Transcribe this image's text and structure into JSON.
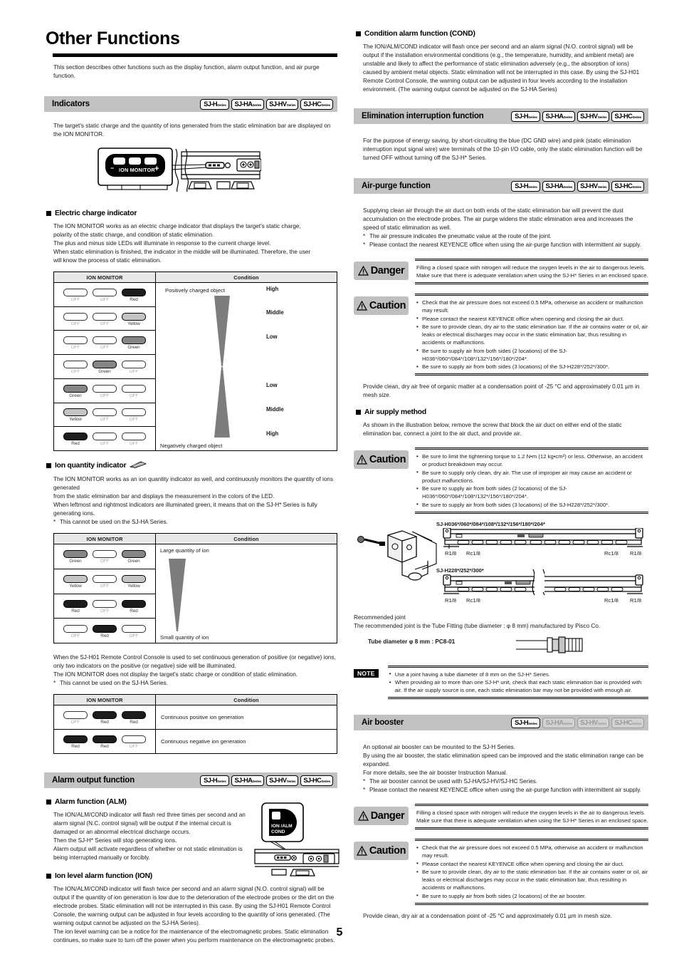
{
  "page": {
    "title": "Other Functions",
    "intro": "This section describes other functions such as the display function, alarm output function, and air purge function.",
    "page_number": "5"
  },
  "badge_labels": {
    "h": "SJ-H",
    "ha": "SJ-HA",
    "hv": "SJ-HV",
    "hc": "SJ-HC",
    "sub": "Series"
  },
  "sections": {
    "indicators": {
      "title": "Indicators",
      "intro": "The target's static charge and the quantity of ions generated from the static elimination bar are displayed on the ION MONITOR.",
      "monitor_label": "ION MONITOR",
      "minus": "–",
      "plus": "+",
      "electric_charge": {
        "heading": "Electric charge indicator",
        "body_lines": [
          "The ION MONITOR works as an electric charge indicator that displays the target's static charge,",
          "polarity of the static charge, and condition of static elimination.",
          "The plus and minus side LEDs will illuminate in response to the current charge level.",
          "When static elimination is finished, the indicator in the middle will be illuminated. Therefore, the user",
          "will know the process of static elimination."
        ],
        "table": {
          "headers": [
            "ION MONITOR",
            "Condition"
          ],
          "top_label": "Positively charged object",
          "bottom_label": "Negatively charged object",
          "rows": [
            {
              "leds": [
                {
                  "state": "off",
                  "label": "OFF"
                },
                {
                  "state": "off",
                  "label": "OFF"
                },
                {
                  "state": "red",
                  "label": "Red"
                }
              ],
              "level": "High"
            },
            {
              "leds": [
                {
                  "state": "off",
                  "label": "OFF"
                },
                {
                  "state": "off",
                  "label": "OFF"
                },
                {
                  "state": "yellow",
                  "label": "Yellow"
                }
              ],
              "level": "Middle"
            },
            {
              "leds": [
                {
                  "state": "off",
                  "label": "OFF"
                },
                {
                  "state": "off",
                  "label": "OFF"
                },
                {
                  "state": "green",
                  "label": "Green"
                }
              ],
              "level": "Low"
            },
            {
              "leds": [
                {
                  "state": "off",
                  "label": "OFF"
                },
                {
                  "state": "green",
                  "label": "Green"
                },
                {
                  "state": "off",
                  "label": "OFF"
                }
              ],
              "level": ""
            },
            {
              "leds": [
                {
                  "state": "green",
                  "label": "Green"
                },
                {
                  "state": "off",
                  "label": "OFF"
                },
                {
                  "state": "off",
                  "label": "OFF"
                }
              ],
              "level": "Low"
            },
            {
              "leds": [
                {
                  "state": "yellow",
                  "label": "Yellow"
                },
                {
                  "state": "off",
                  "label": "OFF"
                },
                {
                  "state": "off",
                  "label": "OFF"
                }
              ],
              "level": "Middle"
            },
            {
              "leds": [
                {
                  "state": "red",
                  "label": "Red"
                },
                {
                  "state": "off",
                  "label": "OFF"
                },
                {
                  "state": "off",
                  "label": "OFF"
                }
              ],
              "level": "High"
            }
          ]
        }
      },
      "ion_quantity": {
        "heading": "Ion quantity indicator",
        "body_lines": [
          "The ION MONITOR works as an ion quantity indicator as well, and continuously monitors the quantity of ions generated",
          "from the static elimination bar and displays the measurement in the colors of the LED.",
          "When leftmost and rightmost indicators are illuminated green, it means that on the SJ-H* Series is fully generating ions."
        ],
        "footnote": "This cannot be used on the SJ-HA Series.",
        "table": {
          "headers": [
            "ION MONITOR",
            "Condition"
          ],
          "top_label": "Large quantity of ion",
          "bottom_label": "Small quantity of ion",
          "rows": [
            {
              "leds": [
                {
                  "state": "green",
                  "label": "Green"
                },
                {
                  "state": "off",
                  "label": "OFF"
                },
                {
                  "state": "green",
                  "label": "Green"
                }
              ]
            },
            {
              "leds": [
                {
                  "state": "yellow",
                  "label": "Yellow"
                },
                {
                  "state": "off",
                  "label": "OFF"
                },
                {
                  "state": "yellow",
                  "label": "Yellow"
                }
              ]
            },
            {
              "leds": [
                {
                  "state": "red",
                  "label": "Red"
                },
                {
                  "state": "off",
                  "label": "OFF"
                },
                {
                  "state": "red",
                  "label": "Red"
                }
              ]
            },
            {
              "leds": [
                {
                  "state": "off",
                  "label": "OFF"
                },
                {
                  "state": "red",
                  "label": "Red"
                },
                {
                  "state": "off",
                  "label": "OFF"
                }
              ]
            }
          ]
        }
      },
      "continuous": {
        "body_lines": [
          "When the SJ-H01 Remote Control Console is used to set continuous generation of positive (or negative) ions, only two indicators on the positive (or negative) side will be illuminated.",
          "The ION MONITOR does not display the target's static charge or condition of static elimination."
        ],
        "footnote": "This cannot be used on the SJ-HA Series.",
        "table": {
          "headers": [
            "ION MONITOR",
            "Condition"
          ],
          "rows": [
            {
              "leds": [
                {
                  "state": "off",
                  "label": "OFF"
                },
                {
                  "state": "red",
                  "label": "Red"
                },
                {
                  "state": "red",
                  "label": "Red"
                }
              ],
              "condition": "Continuous positive ion generation"
            },
            {
              "leds": [
                {
                  "state": "red",
                  "label": "Red"
                },
                {
                  "state": "red",
                  "label": "Red"
                },
                {
                  "state": "off",
                  "label": "OFF"
                }
              ],
              "condition": "Continuous negative ion generation"
            }
          ]
        }
      }
    },
    "alarm_output": {
      "title": "Alarm output function",
      "alm": {
        "heading": "Alarm function (ALM)",
        "body": "The ION/ALM/COND indicator will flash red three times per second and an alarm signal (N.C. control signal) will be output if the internal circuit is damaged or an abnormal electrical discharge occurs.\nThen the SJ-H* Series will stop generating ions.\nAlarm output will activate regardless of whether or not static elimination is being interrupted manually or forcibly.",
        "indicator_label_1": "ION /ALM",
        "indicator_label_2": "COND"
      },
      "ion": {
        "heading": "Ion level alarm function (ION)",
        "body": "The ION/ALM/COND indicator will flash twice per second and an alarm signal (N.O. control signal) will be output if the quantity of ion generation is low due to the deterioration of the electrode probes or the dirt on the electrode probes. Static elimination will not be interrupted in this case. By using the SJ-H01 Remote Control Console, the warning output can be adjusted in four levels according to the quantity of ions generated. (The warning output cannot be adjusted on the SJ-HA Series).\nThe ion level warning can be a notice for the maintenance of the electromagnetic probes. Static elimination continues, so make sure to turn off the power when you perform maintenance on the electromagnetic probes."
      }
    },
    "condition_alarm": {
      "heading": "Condition alarm function (COND)",
      "body": "The ION/ALM/COND indicator will flash once per second and an alarm signal (N.O. control signal) will be output if the installation environmental conditions (e.g., the temperature, humidity, and ambient metal) are unstable and likely to affect the performance of static elimination adversely (e.g., the absorption of ions) caused by ambient metal objects. Static elimination will not be interrupted in this case. By using the SJ-H01 Remote Control Console, the warning output can be adjusted in four levels according to the installation environment. (The warning output cannot be adjusted on the SJ-HA Series)"
    },
    "elimination_interruption": {
      "title": "Elimination interruption function",
      "body": "For the purpose of energy saving, by short-circuiting the blue (DC GND wire) and pink (static elimination interruption input signal wire) wire terminals of the 10-pin I/O cable, only the static elimination function will be turned OFF without turning off the SJ-H* Series."
    },
    "air_purge": {
      "title": "Air-purge function",
      "body": "Supplying clean air through the air duct on both ends of the static elimination bar will prevent the dust accumulation on the electrode probes. The air purge widens the static elimination area and increases the speed of static elimination as well.",
      "footnotes": [
        "The air pressure indicates the pneumatic value at the route of the joint.",
        "Please contact the nearest KEYENCE office when using the air-purge function with intermittent air supply."
      ],
      "danger": {
        "tag": "Danger",
        "text": "Filling a closed space with nitrogen will reduce the oxygen levels in the air to dangerous levels.\nMake sure that there is adequate ventilation when using the SJ-H* Series in an enclosed space."
      },
      "caution": {
        "tag": "Caution",
        "bullets": [
          "Check that the air pressure does not exceed 0.5 MPa, otherwise an accident or malfunction may result.",
          "Please contact the nearest KEYENCE office when opening and closing the air duct.",
          "Be sure to provide clean, dry air to the static elimination bar. If the air contains water or oil, air leaks or electrical discharges may occur in the static elimination bar, thus resulting in accidents or malfunctions.",
          "Be sure to supply air from both sides (2 locations) of the SJ-H036*/060*/084*/108*/132*/156*/180*/204*.",
          "Be sure to supply air from both sides (3 locations) of the SJ-H228*/252*/300*."
        ]
      },
      "after_caution": "Provide clean, dry air free of organic matter at a condensation point of -25 °C and approximately 0.01 µm in mesh size.",
      "air_supply": {
        "heading": "Air supply method",
        "body": "As shown in the illustration below, remove the screw that block the air duct on either end of the static elimination bar, connect a joint to the air duct, and provide air.",
        "caution": {
          "tag": "Caution",
          "bullets": [
            "Be sure to limit the tightening torque to 1.2 N•m (12 kg•cm²) or less. Otherwise, an accident or product breakdown may occur.",
            "Be sure to supply only clean, dry air. The use of improper air may cause an accident or product malfunctions.",
            "Be sure to supply air from both sides (2 locations) of the SJ-H036*/060*/084*/108*/132*/156*/180*/204*.",
            "Be sure to supply air from both sides (3 locations) of the SJ-H228*/252*/300*."
          ]
        },
        "fig1_label": "SJ-H036*/060*/084*/108*/132*/156*/180*/204*",
        "fig2_label": "SJ-H228*/252*/300*",
        "port_left_outer": "R1/8",
        "port_left_inner": "Rc1/8",
        "port_right_inner": "Rc1/8",
        "port_right_outer": "R1/8",
        "joint_heading": "Recommended joint",
        "joint_text": "The recommended joint is the Tube Fitting (tube diameter : φ 8 mm) manufactured by Pisco Co.",
        "tube_label": "Tube diameter φ 8 mm : PC8-01",
        "note": {
          "tag": "NOTE",
          "bullets": [
            "Use a joint having a tube diameter of 8 mm on the SJ-H* Series.",
            "When providing air to more than one SJ-H* unit, check that each static elimination bar is provided with air. If the air supply source is one, each static elimination bar may not be provided with enough air."
          ]
        }
      }
    },
    "air_booster": {
      "title": "Air booster",
      "body_lines": [
        "An optional air booster can be mounted to the SJ-H Series.",
        "By using the air booster, the static elimination speed can be improved and the static elimination range can be expanded.",
        "For more details, see the air booster Instruction Manual."
      ],
      "footnotes": [
        "The air booster cannot be used with SJ-HA/SJ-HV/SJ-HC Series.",
        "Please contact the nearest KEYENCE office when using the air-purge function with intermittent air supply."
      ],
      "danger": {
        "tag": "Danger",
        "text": "Filling a closed space with nitrogen will reduce the oxygen levels in the air to dangerous levels.\nMake sure that there is adequate ventilation when using the SJ-H* Series in an enclosed space."
      },
      "caution": {
        "tag": "Caution",
        "bullets": [
          "Check that the air pressure does not exceed 0.5 MPa, otherwise an accident or malfunction may result.",
          "Please contact the nearest KEYENCE office when opening and closing the air duct.",
          "Be sure to provide clean, dry air to the static elimination bar. If the air contains water or oil, air leaks or electrical discharges may occur in the static elimination bar, thus resulting in accidents or malfunctions.",
          "Be sure to supply air from both sides (2 locations) of the air booster."
        ]
      },
      "after_caution": "Provide clean, dry air at a condensation point of -25 °C and approximately 0.01 µm in mesh size."
    }
  }
}
